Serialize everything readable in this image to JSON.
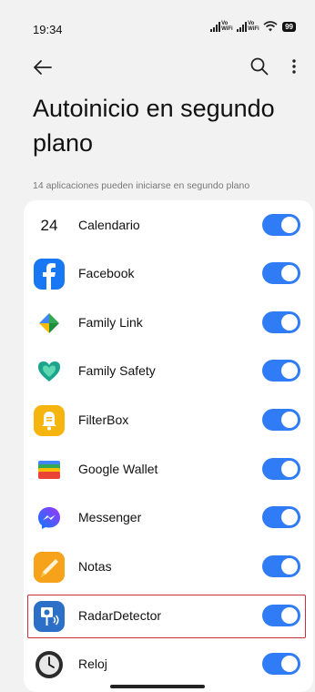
{
  "status_bar": {
    "time": "19:34",
    "sim1_label": "Vo WiFi",
    "sim2_label": "Vo WiFi",
    "battery": "99"
  },
  "top_bar": {
    "back_icon": "arrow-left-icon",
    "search_icon": "search-icon",
    "more_icon": "more-vertical-icon"
  },
  "title": "Autoinicio en segundo plano",
  "subtitle": "14 aplicaciones pueden iniciarse en segundo plano",
  "accent_color": "#2f7cf6",
  "highlight_color": "#c9303e",
  "apps": [
    {
      "name": "Calendario",
      "icon": "calendar-icon",
      "icon_text": "24",
      "enabled": true
    },
    {
      "name": "Facebook",
      "icon": "facebook-icon",
      "enabled": true
    },
    {
      "name": "Family Link",
      "icon": "family-link-icon",
      "enabled": true
    },
    {
      "name": "Family Safety",
      "icon": "family-safety-icon",
      "enabled": true
    },
    {
      "name": "FilterBox",
      "icon": "filterbox-icon",
      "enabled": true
    },
    {
      "name": "Google Wallet",
      "icon": "google-wallet-icon",
      "enabled": true
    },
    {
      "name": "Messenger",
      "icon": "messenger-icon",
      "enabled": true
    },
    {
      "name": "Notas",
      "icon": "notes-icon",
      "enabled": true
    },
    {
      "name": "RadarDetector",
      "icon": "radar-detector-icon",
      "enabled": true,
      "highlighted": true
    },
    {
      "name": "Reloj",
      "icon": "clock-icon",
      "enabled": true
    }
  ]
}
